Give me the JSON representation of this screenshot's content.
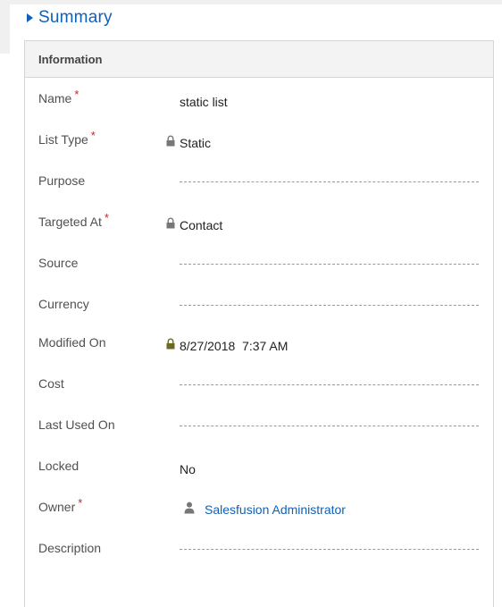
{
  "section": {
    "title": "Summary"
  },
  "panel": {
    "header": "Information"
  },
  "fields": [
    {
      "label": "Name",
      "required": "*",
      "value": "static list"
    },
    {
      "label": "List Type",
      "required": "*",
      "value": "Static",
      "icon": "lock-icon"
    },
    {
      "label": "Purpose",
      "value": ""
    },
    {
      "label": "Targeted At",
      "required": "*",
      "value": "Contact",
      "icon": "lock-icon"
    },
    {
      "label": "Source",
      "value": ""
    },
    {
      "label": "Currency",
      "value": ""
    },
    {
      "label": "Modified On",
      "value": "8/27/2018  7:37 AM",
      "icon": "lock-icon",
      "highlight_color": "#fcff4c"
    },
    {
      "label": "Cost",
      "value": ""
    },
    {
      "label": "Last Used On",
      "value": ""
    },
    {
      "label": "Locked",
      "value": "No"
    },
    {
      "label": "Owner",
      "required": "*",
      "value": "Salesfusion Administrator",
      "icon": "person-icon"
    },
    {
      "label": "Description",
      "value": ""
    }
  ],
  "colors": {
    "accent": "#1160b7",
    "required": "#c0262d",
    "highlight": "#fcff4c"
  }
}
